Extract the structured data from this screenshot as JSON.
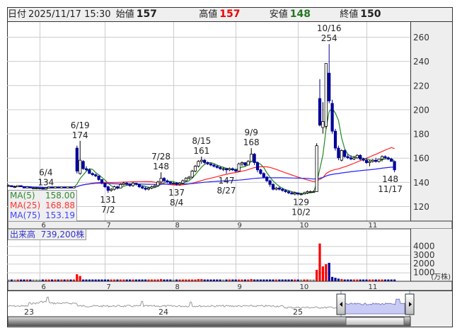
{
  "header": {
    "date_label": "日付",
    "datetime": "2025/11/17 15:30",
    "open_label": "始値",
    "open": "157",
    "high_label": "高値",
    "high": "157",
    "low_label": "安値",
    "low": "148",
    "close_label": "終値",
    "close": "150"
  },
  "ma_legend": [
    {
      "label": "MA(5)",
      "value": "158.00",
      "color": "#338833"
    },
    {
      "label": "MA(25)",
      "value": "168.88",
      "color": "#ff3333"
    },
    {
      "label": "MA(75)",
      "value": "153.19",
      "color": "#4444ff"
    }
  ],
  "volume_legend": {
    "label": "出来高",
    "value": "739,200株"
  },
  "colors": {
    "up_body": "#ffffff",
    "down_body": "#000099",
    "vol_up": "#ff0000",
    "vol_down": "#000099",
    "vol_flat": "#888888",
    "ma5": "#228822",
    "ma25": "#ff2222",
    "ma75": "#2222ff"
  },
  "chart_data": {
    "type": "candlestick",
    "price_axis": {
      "ticks": [
        "120",
        "140",
        "160",
        "180",
        "200",
        "220",
        "240",
        "260"
      ],
      "range": [
        112,
        272
      ]
    },
    "month_labels": [
      {
        "label": "6",
        "day": 10
      },
      {
        "label": "7",
        "day": 31
      },
      {
        "label": "8",
        "day": 53
      },
      {
        "label": "9",
        "day": 73
      },
      {
        "label": "10",
        "day": 93
      },
      {
        "label": "11",
        "day": 115
      }
    ],
    "candles_ohlc": [
      [
        137,
        138,
        136,
        137
      ],
      [
        137,
        137,
        136,
        136
      ],
      [
        136,
        137,
        135,
        136
      ],
      [
        136,
        137,
        136,
        137
      ],
      [
        137,
        137,
        136,
        136
      ],
      [
        136,
        136,
        135,
        135
      ],
      [
        135,
        136,
        135,
        136
      ],
      [
        136,
        136,
        135,
        135
      ],
      [
        135,
        136,
        135,
        135
      ],
      [
        135,
        136,
        134,
        135
      ],
      [
        135,
        135,
        134,
        135
      ],
      [
        135,
        136,
        134,
        134
      ],
      [
        134,
        135,
        134,
        135
      ],
      [
        135,
        136,
        135,
        136
      ],
      [
        136,
        136,
        135,
        135
      ],
      [
        135,
        136,
        135,
        136
      ],
      [
        136,
        136,
        135,
        135
      ],
      [
        135,
        136,
        135,
        136
      ],
      [
        136,
        136,
        135,
        135
      ],
      [
        135,
        136,
        135,
        136
      ],
      [
        136,
        136,
        135,
        135
      ],
      [
        135,
        136,
        135,
        136
      ],
      [
        168,
        170,
        147,
        149
      ],
      [
        147,
        174,
        146,
        158
      ],
      [
        157,
        158,
        150,
        151
      ],
      [
        151,
        153,
        149,
        150
      ],
      [
        150,
        151,
        147,
        147
      ],
      [
        147,
        148,
        145,
        146
      ],
      [
        146,
        147,
        144,
        145
      ],
      [
        145,
        145,
        141,
        142
      ],
      [
        142,
        142,
        138,
        139
      ],
      [
        139,
        139,
        135,
        136
      ],
      [
        136,
        137,
        131,
        133
      ],
      [
        133,
        135,
        132,
        134
      ],
      [
        134,
        137,
        133,
        136
      ],
      [
        136,
        137,
        134,
        135
      ],
      [
        135,
        139,
        135,
        138
      ],
      [
        138,
        140,
        137,
        139
      ],
      [
        139,
        140,
        137,
        138
      ],
      [
        138,
        139,
        136,
        137
      ],
      [
        137,
        140,
        136,
        139
      ],
      [
        139,
        139,
        137,
        138
      ],
      [
        138,
        138,
        135,
        136
      ],
      [
        136,
        137,
        134,
        135
      ],
      [
        135,
        136,
        133,
        134
      ],
      [
        134,
        136,
        133,
        135
      ],
      [
        135,
        137,
        134,
        136
      ],
      [
        136,
        138,
        135,
        137
      ],
      [
        137,
        141,
        136,
        140
      ],
      [
        140,
        148,
        139,
        143
      ],
      [
        143,
        144,
        140,
        141
      ],
      [
        141,
        142,
        139,
        140
      ],
      [
        140,
        140,
        138,
        139
      ],
      [
        139,
        140,
        138,
        139
      ],
      [
        139,
        140,
        137,
        138
      ],
      [
        138,
        140,
        137,
        139
      ],
      [
        139,
        142,
        138,
        141
      ],
      [
        141,
        144,
        140,
        143
      ],
      [
        143,
        145,
        142,
        144
      ],
      [
        144,
        150,
        143,
        149
      ],
      [
        149,
        154,
        148,
        153
      ],
      [
        153,
        158,
        152,
        157
      ],
      [
        157,
        161,
        155,
        158
      ],
      [
        158,
        159,
        155,
        156
      ],
      [
        156,
        157,
        154,
        155
      ],
      [
        155,
        156,
        153,
        154
      ],
      [
        154,
        155,
        152,
        153
      ],
      [
        153,
        154,
        151,
        152
      ],
      [
        152,
        153,
        150,
        151
      ],
      [
        151,
        152,
        149,
        151
      ],
      [
        151,
        151,
        147,
        150
      ],
      [
        150,
        152,
        149,
        151
      ],
      [
        151,
        152,
        149,
        150
      ],
      [
        150,
        151,
        148,
        149
      ],
      [
        149,
        156,
        149,
        155
      ],
      [
        155,
        157,
        153,
        156
      ],
      [
        156,
        156,
        153,
        154
      ],
      [
        154,
        158,
        154,
        157
      ],
      [
        157,
        168,
        157,
        163
      ],
      [
        163,
        164,
        154,
        156
      ],
      [
        156,
        157,
        148,
        150
      ],
      [
        150,
        151,
        146,
        147
      ],
      [
        147,
        148,
        143,
        144
      ],
      [
        144,
        145,
        140,
        141
      ],
      [
        141,
        142,
        136,
        138
      ],
      [
        138,
        139,
        133,
        134
      ],
      [
        134,
        136,
        133,
        135
      ],
      [
        135,
        136,
        133,
        134
      ],
      [
        134,
        135,
        132,
        133
      ],
      [
        133,
        134,
        131,
        132
      ],
      [
        132,
        133,
        130,
        131
      ],
      [
        131,
        132,
        130,
        130
      ],
      [
        130,
        132,
        129,
        131
      ],
      [
        131,
        131,
        129,
        130
      ],
      [
        130,
        131,
        129,
        130
      ],
      [
        130,
        132,
        130,
        131
      ],
      [
        131,
        133,
        130,
        132
      ],
      [
        132,
        133,
        131,
        132
      ],
      [
        132,
        133,
        131,
        132
      ],
      [
        132,
        172,
        132,
        170
      ],
      [
        209,
        225,
        186,
        187
      ],
      [
        185,
        206,
        180,
        190
      ],
      [
        186,
        238,
        184,
        238
      ],
      [
        230,
        254,
        205,
        207
      ],
      [
        205,
        208,
        180,
        182
      ],
      [
        182,
        184,
        166,
        168
      ],
      [
        168,
        170,
        158,
        160
      ],
      [
        158,
        167,
        157,
        166
      ],
      [
        166,
        167,
        160,
        161
      ],
      [
        161,
        163,
        159,
        160
      ],
      [
        160,
        162,
        158,
        159
      ],
      [
        159,
        161,
        158,
        160
      ],
      [
        160,
        163,
        159,
        162
      ],
      [
        162,
        163,
        158,
        159
      ],
      [
        159,
        160,
        157,
        158
      ],
      [
        158,
        160,
        155,
        156
      ],
      [
        156,
        158,
        153,
        157
      ],
      [
        157,
        159,
        156,
        158
      ],
      [
        158,
        160,
        156,
        157
      ],
      [
        157,
        159,
        156,
        159
      ],
      [
        159,
        162,
        157,
        161
      ],
      [
        161,
        162,
        159,
        160
      ],
      [
        160,
        161,
        158,
        159
      ],
      [
        159,
        160,
        157,
        157
      ],
      [
        157,
        157,
        148,
        150
      ]
    ],
    "annotations": [
      {
        "date": "6/4",
        "price": "134",
        "day": 12,
        "pos": "above"
      },
      {
        "date": "6/19",
        "price": "174",
        "day": 23,
        "pos": "above"
      },
      {
        "date": "7/2",
        "price": "131",
        "day": 32,
        "pos": "below"
      },
      {
        "date": "7/28",
        "price": "148",
        "day": 49,
        "pos": "above"
      },
      {
        "date": "8/4",
        "price": "137",
        "day": 54,
        "pos": "below"
      },
      {
        "date": "8/15",
        "price": "161",
        "day": 62,
        "pos": "above"
      },
      {
        "date": "8/27",
        "price": "147",
        "day": 70,
        "pos": "below"
      },
      {
        "date": "9/9",
        "price": "168",
        "day": 78,
        "pos": "above"
      },
      {
        "date": "10/2",
        "price": "129",
        "day": 94,
        "pos": "below"
      },
      {
        "date": "10/16",
        "price": "254",
        "day": 103,
        "pos": "above"
      },
      {
        "date": "11/17",
        "price": "148",
        "day": 124,
        "pos": "below"
      }
    ],
    "volume_unit": "(万株)",
    "volume_ticks": [
      "1000",
      "2000",
      "3000",
      "4000"
    ],
    "volumes": [
      150,
      150,
      150,
      150,
      150,
      150,
      150,
      150,
      150,
      150,
      150,
      150,
      150,
      150,
      150,
      150,
      150,
      150,
      150,
      150,
      150,
      150,
      800,
      600,
      200,
      150,
      150,
      150,
      150,
      150,
      150,
      150,
      150,
      150,
      150,
      150,
      150,
      150,
      150,
      150,
      150,
      150,
      150,
      150,
      150,
      150,
      150,
      150,
      200,
      250,
      150,
      150,
      150,
      150,
      150,
      150,
      150,
      150,
      150,
      150,
      200,
      250,
      250,
      200,
      150,
      150,
      150,
      150,
      150,
      150,
      150,
      150,
      150,
      150,
      150,
      150,
      150,
      200,
      250,
      200,
      200,
      150,
      150,
      150,
      200,
      150,
      150,
      150,
      150,
      150,
      150,
      150,
      150,
      150,
      150,
      150,
      150,
      150,
      150,
      1300,
      4300,
      1700,
      1950,
      2100,
      500,
      400,
      300,
      250,
      200,
      200,
      200,
      150,
      150,
      150,
      150,
      150,
      150,
      150,
      150,
      150,
      150,
      150,
      150,
      150,
      150
    ],
    "navigator": {
      "year_labels": [
        "23",
        "24",
        "25"
      ]
    }
  }
}
